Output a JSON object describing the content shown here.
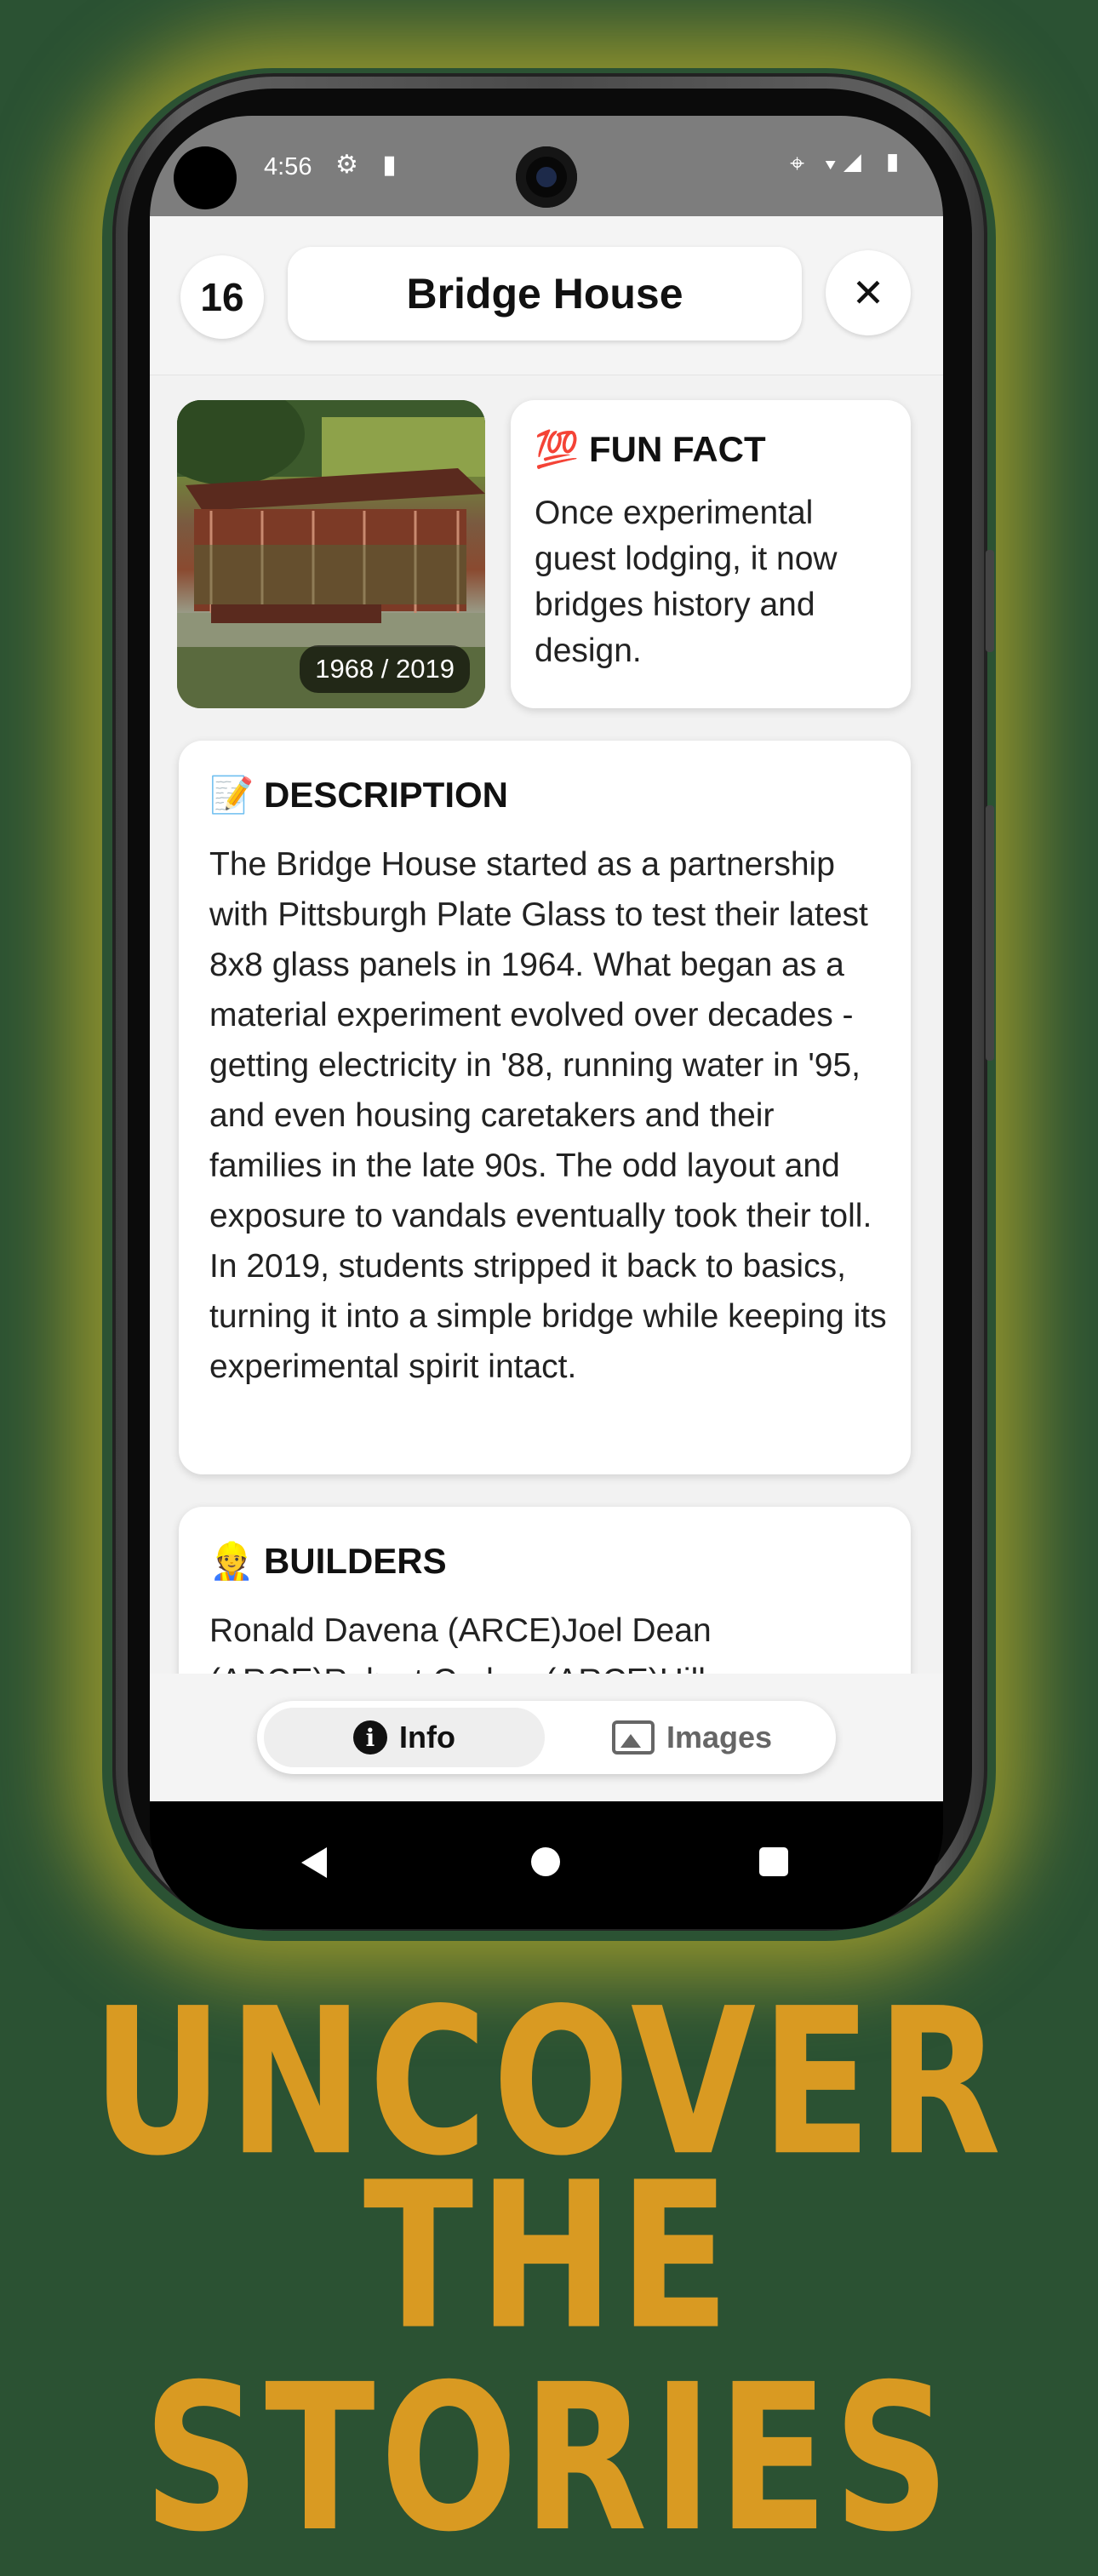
{
  "status_bar": {
    "time": "4:56",
    "left_icons": "⚙ ▮",
    "right_icons": "⌖ ▾◢ ▮"
  },
  "header": {
    "number": "16",
    "title": "Bridge House",
    "close_label": "✕"
  },
  "photo": {
    "year_badge": "1968 / 2019"
  },
  "fun_fact": {
    "emoji": "💯",
    "title": "FUN FACT",
    "text": "Once experimental guest lodging, it now bridges history and design."
  },
  "description": {
    "emoji": "📝",
    "title": "DESCRIPTION",
    "text": "The Bridge House started as a partnership with Pittsburgh Plate Glass to test their latest 8x8 glass panels in 1964. What began as a material experiment evolved over decades - getting electricity in '88, running water in '95, and even housing caretakers and their families in the late 90s. The odd layout and exposure to vandals eventually took their toll. In 2019, students stripped it back to basics, turning it into a simple bridge while keeping its experimental spirit intact."
  },
  "builders": {
    "emoji": "👷",
    "title": "BUILDERS",
    "text": "Ronald Davena (ARCE)Joel Dean (ARCE)Robert Carlow (ARCE)Hillen"
  },
  "tabs": {
    "info_label": "Info",
    "images_label": "Images",
    "info_icon": "i"
  },
  "headline": {
    "line1": "UNCOVER",
    "line2": "THE STORIES"
  }
}
